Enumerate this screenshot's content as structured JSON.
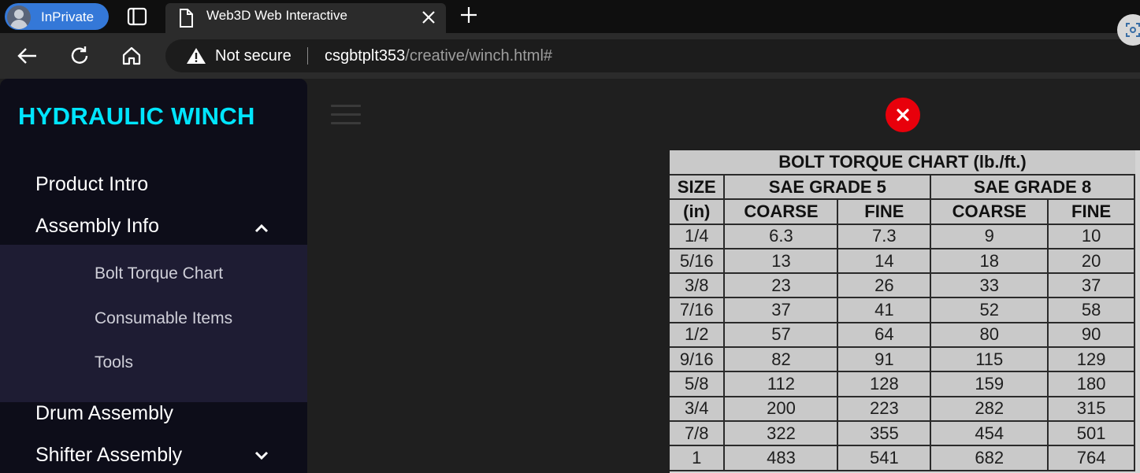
{
  "browser": {
    "profile_label": "InPrivate",
    "tab_title": "Web3D Web Interactive",
    "security_label": "Not secure",
    "url_host": "csgbtplt353",
    "url_path": "/creative/winch.html#"
  },
  "sidebar": {
    "brand": "HYDRAULIC WINCH",
    "items": [
      {
        "label": "Product Intro"
      },
      {
        "label": "Assembly Info"
      },
      {
        "label": "Drum Assembly"
      },
      {
        "label": "Shifter Assembly"
      }
    ],
    "submenu": [
      {
        "label": "Bolt Torque Chart"
      },
      {
        "label": "Consumable Items"
      },
      {
        "label": "Tools"
      }
    ]
  },
  "chart_table": {
    "title": "BOLT TORQUE CHART (lb./ft.)",
    "size_header": "SIZE",
    "size_unit": "(in)",
    "group_headers": [
      "SAE GRADE 5",
      "SAE GRADE 8"
    ],
    "sub_headers": [
      "COARSE",
      "FINE",
      "COARSE",
      "FINE"
    ],
    "rows": [
      [
        "1/4",
        "6.3",
        "7.3",
        "9",
        "10"
      ],
      [
        "5/16",
        "13",
        "14",
        "18",
        "20"
      ],
      [
        "3/8",
        "23",
        "26",
        "33",
        "37"
      ],
      [
        "7/16",
        "37",
        "41",
        "52",
        "58"
      ],
      [
        "1/2",
        "57",
        "64",
        "80",
        "90"
      ],
      [
        "9/16",
        "82",
        "91",
        "115",
        "129"
      ],
      [
        "5/8",
        "112",
        "128",
        "159",
        "180"
      ],
      [
        "3/4",
        "200",
        "223",
        "282",
        "315"
      ],
      [
        "7/8",
        "322",
        "355",
        "454",
        "501"
      ],
      [
        "1",
        "483",
        "541",
        "682",
        "764"
      ]
    ]
  },
  "colors": {
    "brand": "#00e5ff",
    "close_button": "#e8000b",
    "sidebar_bg": "#0d0d19",
    "submenu_bg": "#1e1c33"
  }
}
